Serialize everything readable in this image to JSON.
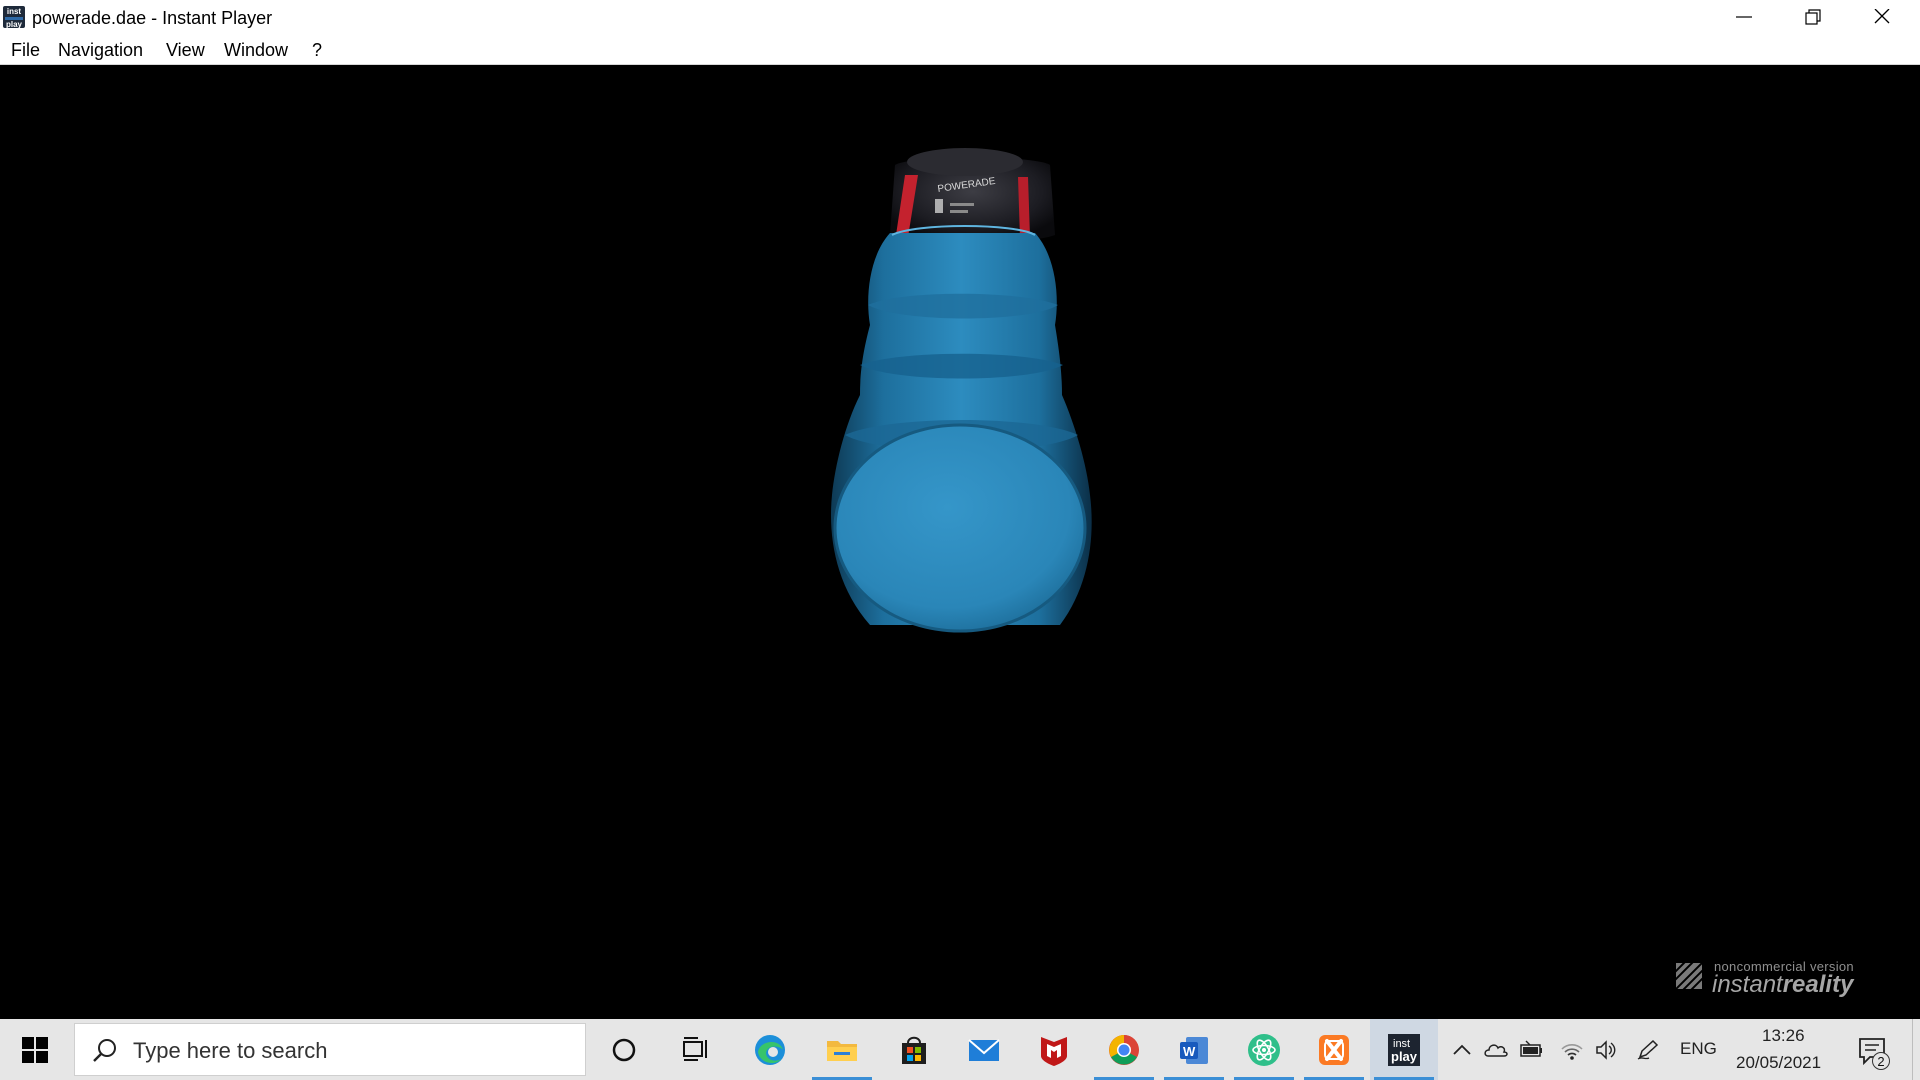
{
  "window": {
    "title": "powerade.dae - Instant Player",
    "icon_label_top": "inst",
    "icon_label_bottom": "play"
  },
  "menu": {
    "items": [
      "File",
      "Navigation",
      "View",
      "Window",
      "?"
    ]
  },
  "viewport": {
    "background": "#000000",
    "object": "powerade-bottle",
    "bottle_color": "#2a86b8",
    "label_text": "POWERADE",
    "watermark_small": "noncommercial version",
    "watermark_big_light": "instant",
    "watermark_big_bold": "reality"
  },
  "taskbar": {
    "search_placeholder": "Type here to search",
    "pinned": [
      {
        "name": "cortana-icon"
      },
      {
        "name": "task-view-icon"
      },
      {
        "name": "edge-icon"
      },
      {
        "name": "file-explorer-icon"
      },
      {
        "name": "store-icon"
      },
      {
        "name": "mail-icon"
      },
      {
        "name": "mcafee-icon"
      },
      {
        "name": "chrome-icon"
      },
      {
        "name": "word-icon"
      },
      {
        "name": "atom-icon"
      },
      {
        "name": "xampp-icon"
      },
      {
        "name": "instant-player-icon",
        "label_top": "inst",
        "label_bottom": "play"
      }
    ],
    "tray": {
      "language": "ENG",
      "time": "13:26",
      "date": "20/05/2021",
      "notification_count": "2"
    }
  },
  "colors": {
    "accent": "#3b8fd6",
    "taskbar": "#e6e6e6"
  }
}
